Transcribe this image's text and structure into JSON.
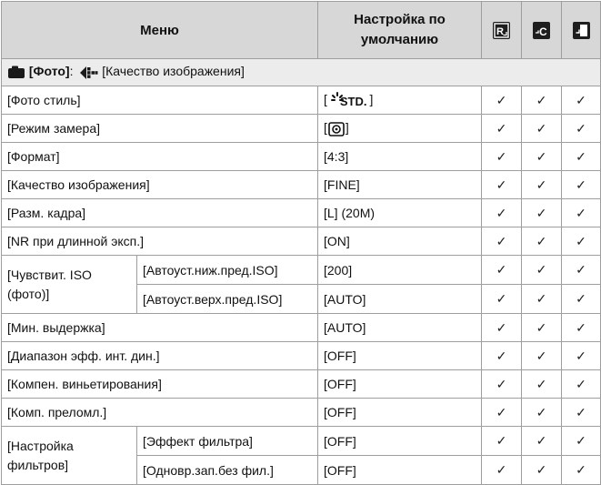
{
  "header": {
    "menu": "Меню",
    "default_line1": "Настройка по",
    "default_line2": "умолчанию",
    "icons": [
      "reset-R-icon",
      "reset-C-icon",
      "reset-restore-icon"
    ]
  },
  "section": {
    "photo_label": "[Фото]",
    "sep": ":",
    "submenu_label": "[Качество изображения]",
    "icons": [
      "camera-icon",
      "image-quality-menu-icon"
    ]
  },
  "check": "✓",
  "rows": {
    "photo_style": {
      "name": "[Фото стиль]",
      "value_open": "[",
      "value_std": "STD.",
      "value_close": "]"
    },
    "metering": {
      "name": "[Режим замера]",
      "value_open": "[",
      "value_close": "]"
    },
    "aspect": {
      "name": "[Формат]",
      "value": "[4:3]"
    },
    "quality": {
      "name": "[Качество изображения]",
      "value": "[FINE]"
    },
    "size": {
      "name": "[Разм. кадра]",
      "value": "[L] (20M)"
    },
    "long_nr": {
      "name": "[NR при длинной эксп.]",
      "value": "[ON]"
    },
    "iso_group": {
      "line1": "[Чувствит. ISO",
      "line2": "(фото)]"
    },
    "iso_lower": {
      "name": "[Автоуст.ниж.пред.ISO]",
      "value": "[200]"
    },
    "iso_upper": {
      "name": "[Автоуст.верх.пред.ISO]",
      "value": "[AUTO]"
    },
    "min_shutter": {
      "name": "[Мин. выдержка]",
      "value": "[AUTO]"
    },
    "idr": {
      "name": "[Диапазон эфф. инт. дин.]",
      "value": "[OFF]"
    },
    "vignette": {
      "name": "[Компен. виньетирования]",
      "value": "[OFF]"
    },
    "diffraction": {
      "name": "[Комп. преломл.]",
      "value": "[OFF]"
    },
    "filter_group": {
      "line1": "[Настройка",
      "line2": "фильтров]"
    },
    "filter_effect": {
      "name": "[Эффект фильтра]",
      "value": "[OFF]"
    },
    "simul_record": {
      "name": "[Одновр.зап.без фил.]",
      "value": "[OFF]"
    }
  }
}
